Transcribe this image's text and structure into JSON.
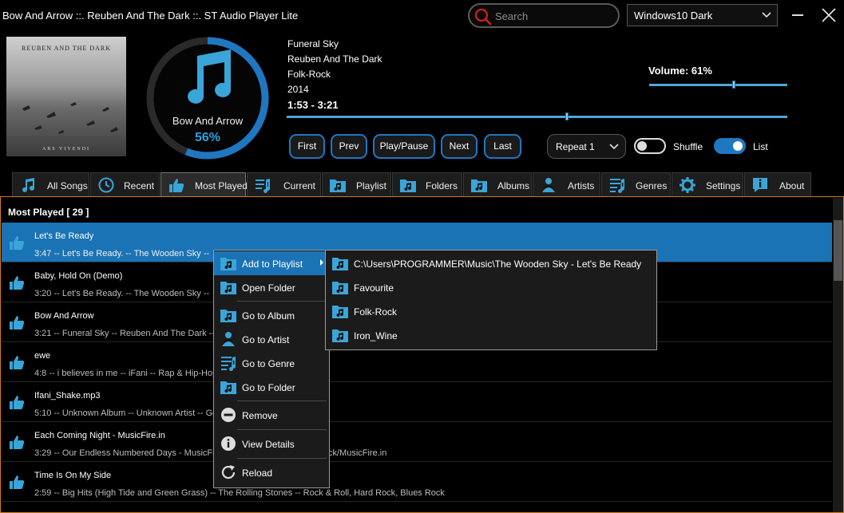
{
  "window": {
    "title": "Bow And Arrow ::. Reuben And The Dark ::. ST Audio Player Lite",
    "search_placeholder": "Search",
    "theme": "Windows10 Dark"
  },
  "album_art": {
    "title_text": "REUBEN AND THE DARK",
    "bottom_text": "ARS VIVENDI"
  },
  "now_playing": {
    "song": "Bow And Arrow",
    "progress_percent": "56%",
    "album": "Funeral Sky",
    "artist": "Reuben And The Dark",
    "genre": "Folk-Rock",
    "year": "2014",
    "time": "1:53 - 3:21",
    "seek_fraction": 0.56
  },
  "volume": {
    "label": "Volume: 61%",
    "fraction": 0.61
  },
  "controls": {
    "first": "First",
    "prev": "Prev",
    "play_pause": "Play/Pause",
    "next": "Next",
    "last": "Last",
    "repeat": "Repeat 1",
    "shuffle_label": "Shuffle",
    "shuffle_on": false,
    "list_label": "List",
    "list_on": true
  },
  "tabs": [
    {
      "label": "All Songs",
      "icon": "music-note-icon"
    },
    {
      "label": "Recent",
      "icon": "clock-icon"
    },
    {
      "label": "Most Played",
      "icon": "thumbs-up-icon",
      "active": true
    },
    {
      "label": "Current",
      "icon": "current-list-icon"
    },
    {
      "label": "Playlist",
      "icon": "playlist-folder-icon"
    },
    {
      "label": "Folders",
      "icon": "folder-icon"
    },
    {
      "label": "Albums",
      "icon": "album-icon"
    },
    {
      "label": "Artists",
      "icon": "artist-icon"
    },
    {
      "label": "Genres",
      "icon": "genre-icon"
    },
    {
      "label": "Settings",
      "icon": "gear-icon"
    },
    {
      "label": "About",
      "icon": "info-icon"
    }
  ],
  "list": {
    "header": "Most Played [ 29 ]",
    "rows": [
      {
        "title": "Let's Be Ready",
        "details": "3:47 -- Let's Be Ready. -- The Wooden Sky -- ",
        "selected": true
      },
      {
        "title": "Baby, Hold On (Demo)",
        "details": "3:20 -- Let's Be Ready. -- The Wooden Sky -- "
      },
      {
        "title": "Bow And Arrow",
        "details": "3:21 -- Funeral Sky -- Reuben And The Dark -- "
      },
      {
        "title": "ewe",
        "details": "4:8 -- i believes in me -- iFani -- Rap & Hip-Hop"
      },
      {
        "title": "Ifani_Shake.mp3",
        "details": "5:10 -- Unknown Album -- Unknown Artist -- Ge"
      },
      {
        "title": "Each Coming Night - MusicFire.in",
        "details": "3:29 -- Our Endless Numbered Days - MusicFire.in -- Iron & Wine -- Pop/Rock/MusicFire.in"
      },
      {
        "title": "Time Is On My Side",
        "details": "2:59 -- Big Hits (High Tide and Green Grass) -- The Rolling Stones -- Rock & Roll, Hard Rock, Blues Rock"
      }
    ]
  },
  "context_menu": {
    "items": [
      {
        "label": "Add to Playlist",
        "icon": "playlist-icon",
        "highlighted": true,
        "submenu": true
      },
      {
        "label": "Open Folder",
        "icon": "open-folder-icon"
      },
      {
        "label": "Go to Album",
        "icon": "album-icon"
      },
      {
        "label": "Go to Artist",
        "icon": "artist-icon"
      },
      {
        "label": "Go to Genre",
        "icon": "genre-icon"
      },
      {
        "label": "Go to Folder",
        "icon": "folder-icon"
      },
      {
        "label": "Remove",
        "icon": "remove-icon"
      },
      {
        "label": "View Details",
        "icon": "info-icon"
      },
      {
        "label": "Reload",
        "icon": "reload-icon"
      }
    ]
  },
  "submenu": {
    "items": [
      {
        "label": "C:\\Users\\PROGRAMMER\\Music\\The Wooden Sky - Let's Be Ready"
      },
      {
        "label": "Favourite"
      },
      {
        "label": "Folk-Rock"
      },
      {
        "label": "Iron_Wine"
      }
    ]
  },
  "colors": {
    "accent": "#1a73b5",
    "ring": "#1f77c1",
    "icon": "#3aa5d8",
    "panel_border": "#d07a1a"
  }
}
